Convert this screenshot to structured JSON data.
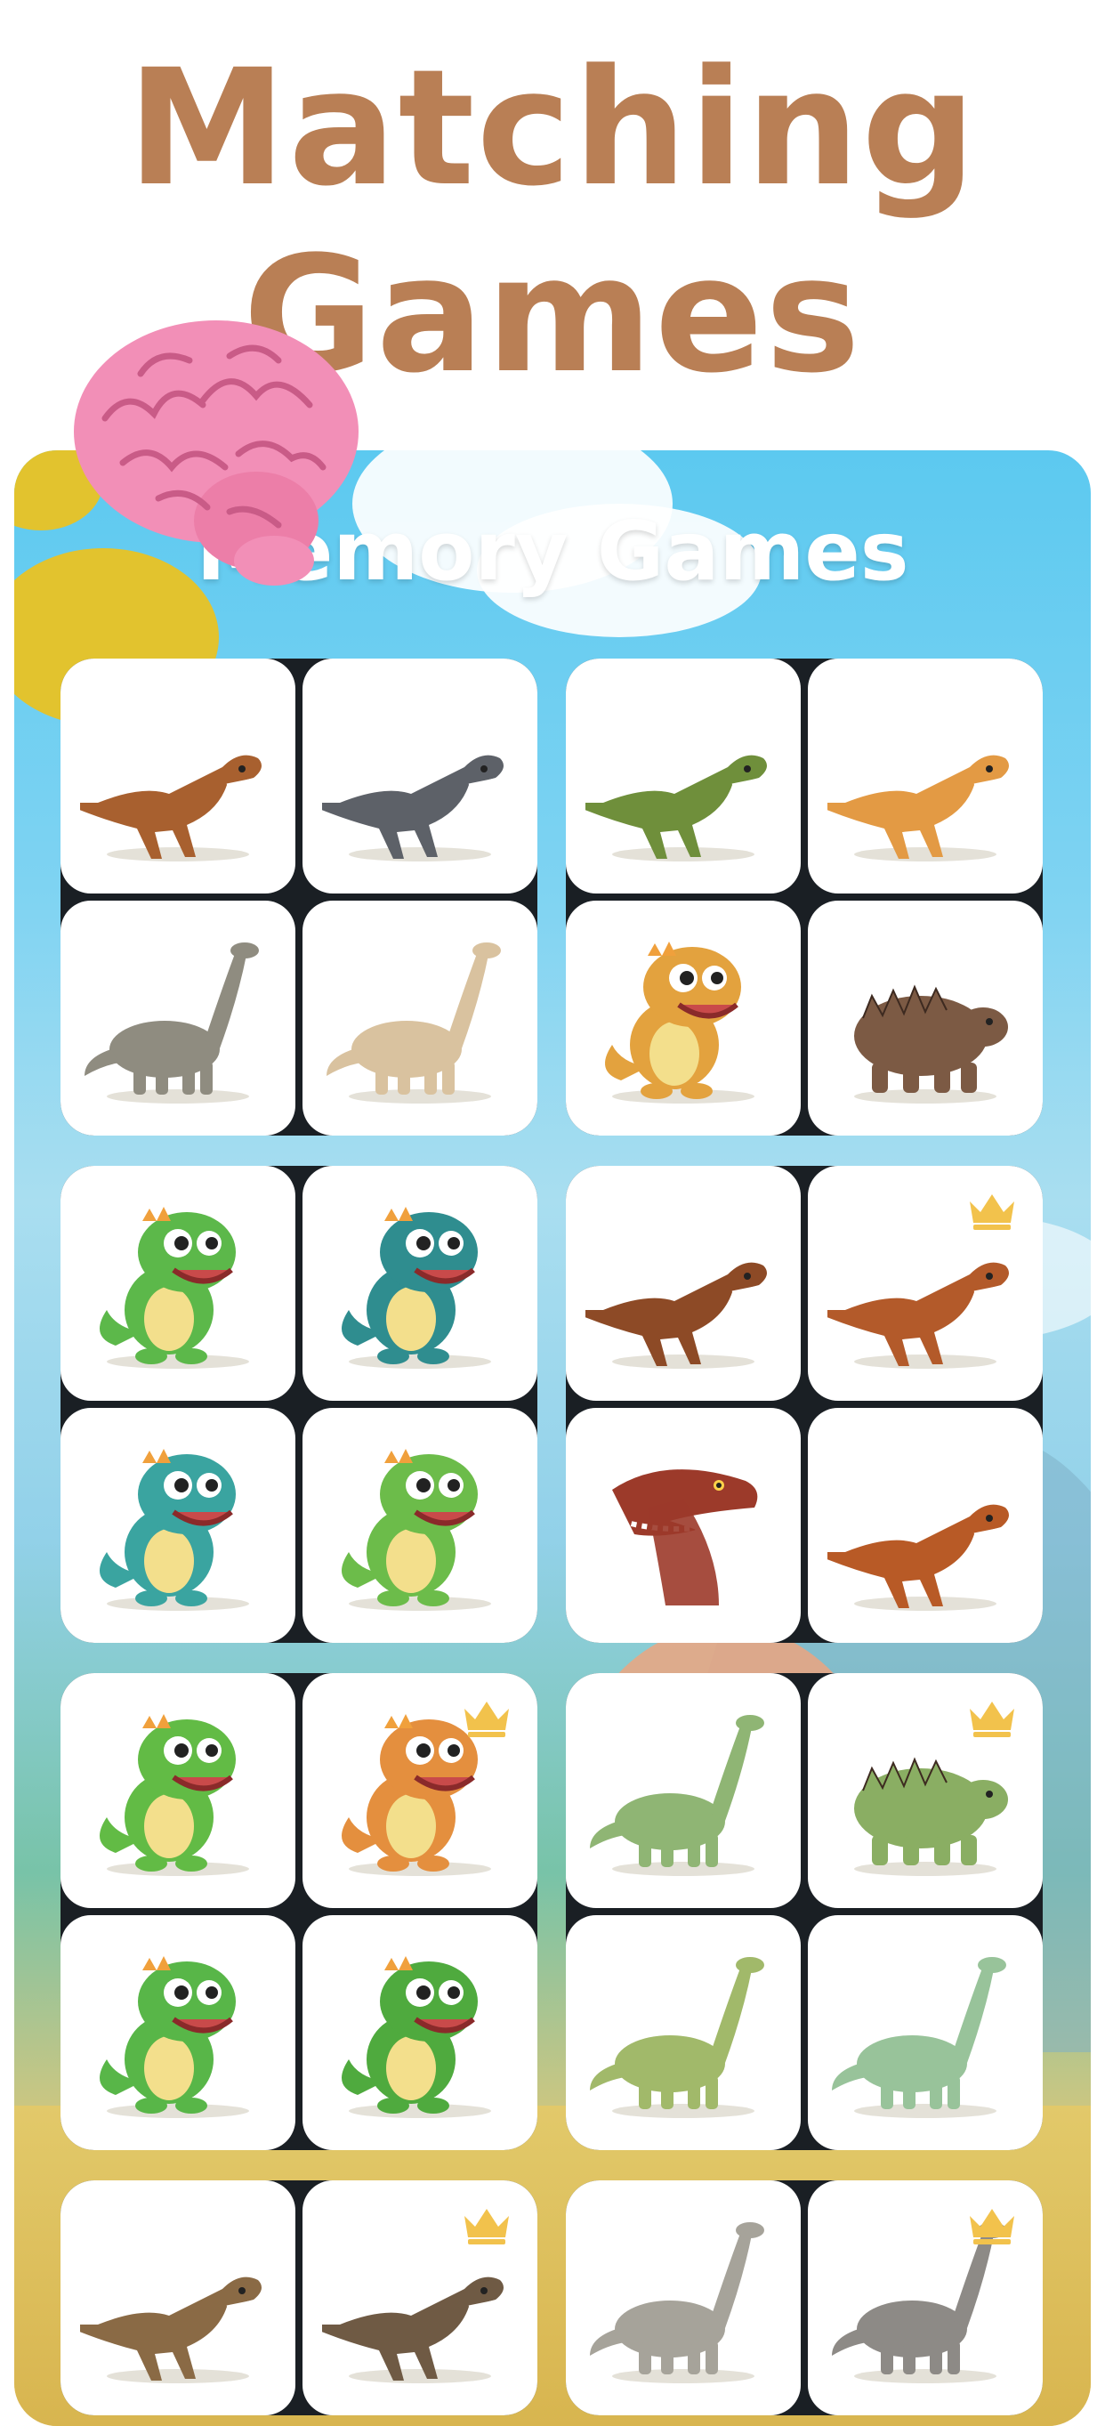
{
  "header": {
    "title_line1": "Matching",
    "title_line2": "Games"
  },
  "panel": {
    "title": "Memory Games"
  },
  "colors": {
    "title_brown": "#b97f55",
    "sky_blue": "#5cc9f0",
    "crown_gold": "#f2c24c",
    "card_bg": "#ffffff",
    "group_bg": "#1a1f24"
  },
  "groups": [
    {
      "cards": [
        {
          "name": "trex-brown-orange",
          "locked": false,
          "color": "#a8602f",
          "style": "realistic"
        },
        {
          "name": "trex-grey",
          "locked": false,
          "color": "#5d6168",
          "style": "realistic"
        },
        {
          "name": "sauropod-grey",
          "locked": false,
          "color": "#8f8c80",
          "style": "long-neck"
        },
        {
          "name": "sauropod-beige",
          "locked": false,
          "color": "#d9c29f",
          "style": "long-neck"
        }
      ]
    },
    {
      "cards": [
        {
          "name": "trex-green-realistic",
          "locked": false,
          "color": "#6f8f3b",
          "style": "realistic"
        },
        {
          "name": "raptor-orange",
          "locked": false,
          "color": "#e39a44",
          "style": "realistic"
        },
        {
          "name": "cartoon-orange-spiked",
          "locked": false,
          "color": "#e3a23e",
          "style": "cartoon"
        },
        {
          "name": "ankylosaur-brown",
          "locked": false,
          "color": "#7c5a44",
          "style": "quad"
        }
      ]
    },
    {
      "cards": [
        {
          "name": "cartoon-green-orange",
          "locked": false,
          "color": "#5cb84a",
          "style": "cartoon"
        },
        {
          "name": "cartoon-teal",
          "locked": false,
          "color": "#2f8d8f",
          "style": "cartoon"
        },
        {
          "name": "cartoon-teal-big",
          "locked": false,
          "color": "#3aa4a0",
          "style": "cartoon"
        },
        {
          "name": "cartoon-green-purple",
          "locked": false,
          "color": "#6cbc4a",
          "style": "cartoon"
        }
      ]
    },
    {
      "cards": [
        {
          "name": "raptor-brown",
          "locked": false,
          "color": "#8d4a26",
          "style": "realistic"
        },
        {
          "name": "raptor-feathered",
          "locked": true,
          "color": "#b35a2a",
          "style": "realistic"
        },
        {
          "name": "trex-head-red",
          "locked": false,
          "color": "#9c3a2a",
          "style": "head"
        },
        {
          "name": "raptor-orange-feathered",
          "locked": false,
          "color": "#b85a26",
          "style": "realistic"
        }
      ]
    },
    {
      "cards": [
        {
          "name": "cartoon-green-smile",
          "locked": false,
          "color": "#62bb45",
          "style": "cartoon"
        },
        {
          "name": "cartoon-orange",
          "locked": true,
          "color": "#e48f3e",
          "style": "cartoon"
        },
        {
          "name": "cartoon-green-small",
          "locked": false,
          "color": "#58b648",
          "style": "cartoon"
        },
        {
          "name": "cartoon-green-big",
          "locked": false,
          "color": "#4faa3e",
          "style": "cartoon"
        }
      ]
    },
    {
      "cards": [
        {
          "name": "sauropod-green",
          "locked": false,
          "color": "#8fb574",
          "style": "long-neck"
        },
        {
          "name": "stegosaur-green",
          "locked": true,
          "color": "#8aae63",
          "style": "quad"
        },
        {
          "name": "brachiosaur-green",
          "locked": false,
          "color": "#a1b96a",
          "style": "long-neck"
        },
        {
          "name": "brachiosaur-pale-green",
          "locked": false,
          "color": "#98c39a",
          "style": "long-neck"
        }
      ]
    },
    {
      "cards": [
        {
          "name": "trex-realistic-brown",
          "locked": false,
          "color": "#8a6a45",
          "style": "realistic"
        },
        {
          "name": "trex-realistic-dark",
          "locked": true,
          "color": "#6f5a44",
          "style": "realistic"
        }
      ]
    },
    {
      "cards": [
        {
          "name": "sauropod-landscape",
          "locked": false,
          "color": "#a6a39a",
          "style": "long-neck"
        },
        {
          "name": "sauropod-landscape-2",
          "locked": true,
          "color": "#8d8a86",
          "style": "long-neck"
        }
      ]
    }
  ]
}
